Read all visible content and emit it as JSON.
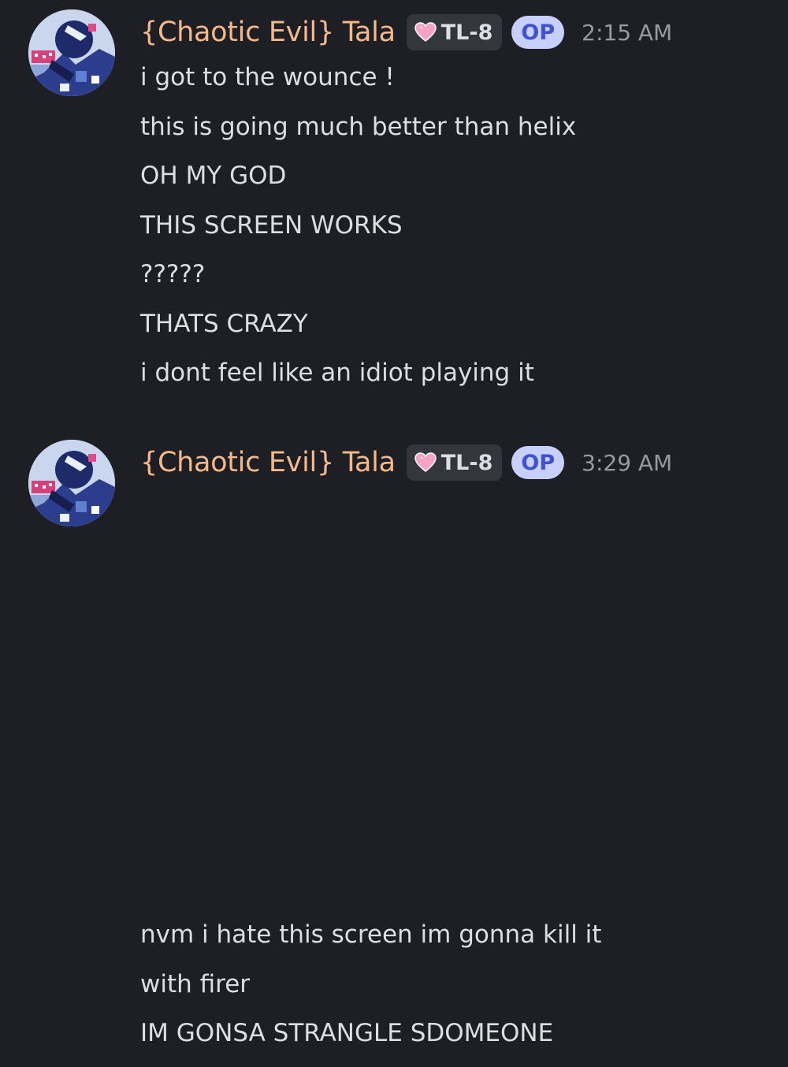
{
  "groups": [
    {
      "username": "{Chaotic Evil} Tala",
      "tag": "TL-8",
      "op_badge": "OP",
      "time": "2:15 AM",
      "messages": [
        "i got to the wounce !",
        "this is going much better than helix",
        "OH MY GOD",
        "THIS SCREEN WORKS",
        "?????",
        "THATS CRAZY",
        "i dont feel like an idiot playing it"
      ]
    },
    {
      "username": "{Chaotic Evil} Tala",
      "tag": "TL-8",
      "op_badge": "OP",
      "time": "3:29 AM",
      "messages": [
        "nvm i hate this screen im gonna kill it",
        "with firer",
        "IM GONSA STRANGLE SDOMEONE"
      ]
    }
  ],
  "icons": {
    "tag_icon": "heart-icon",
    "avatar": "pixel-art-character-avatar"
  },
  "colors": {
    "background": "#1e1f24",
    "username": "#f3b98a",
    "message_text": "#dcdee2",
    "timestamp": "#979aa2",
    "tag_background": "#34363d",
    "op_background": "#c7d0ff",
    "op_text": "#4051d6",
    "heart": "#f4a3c4"
  }
}
